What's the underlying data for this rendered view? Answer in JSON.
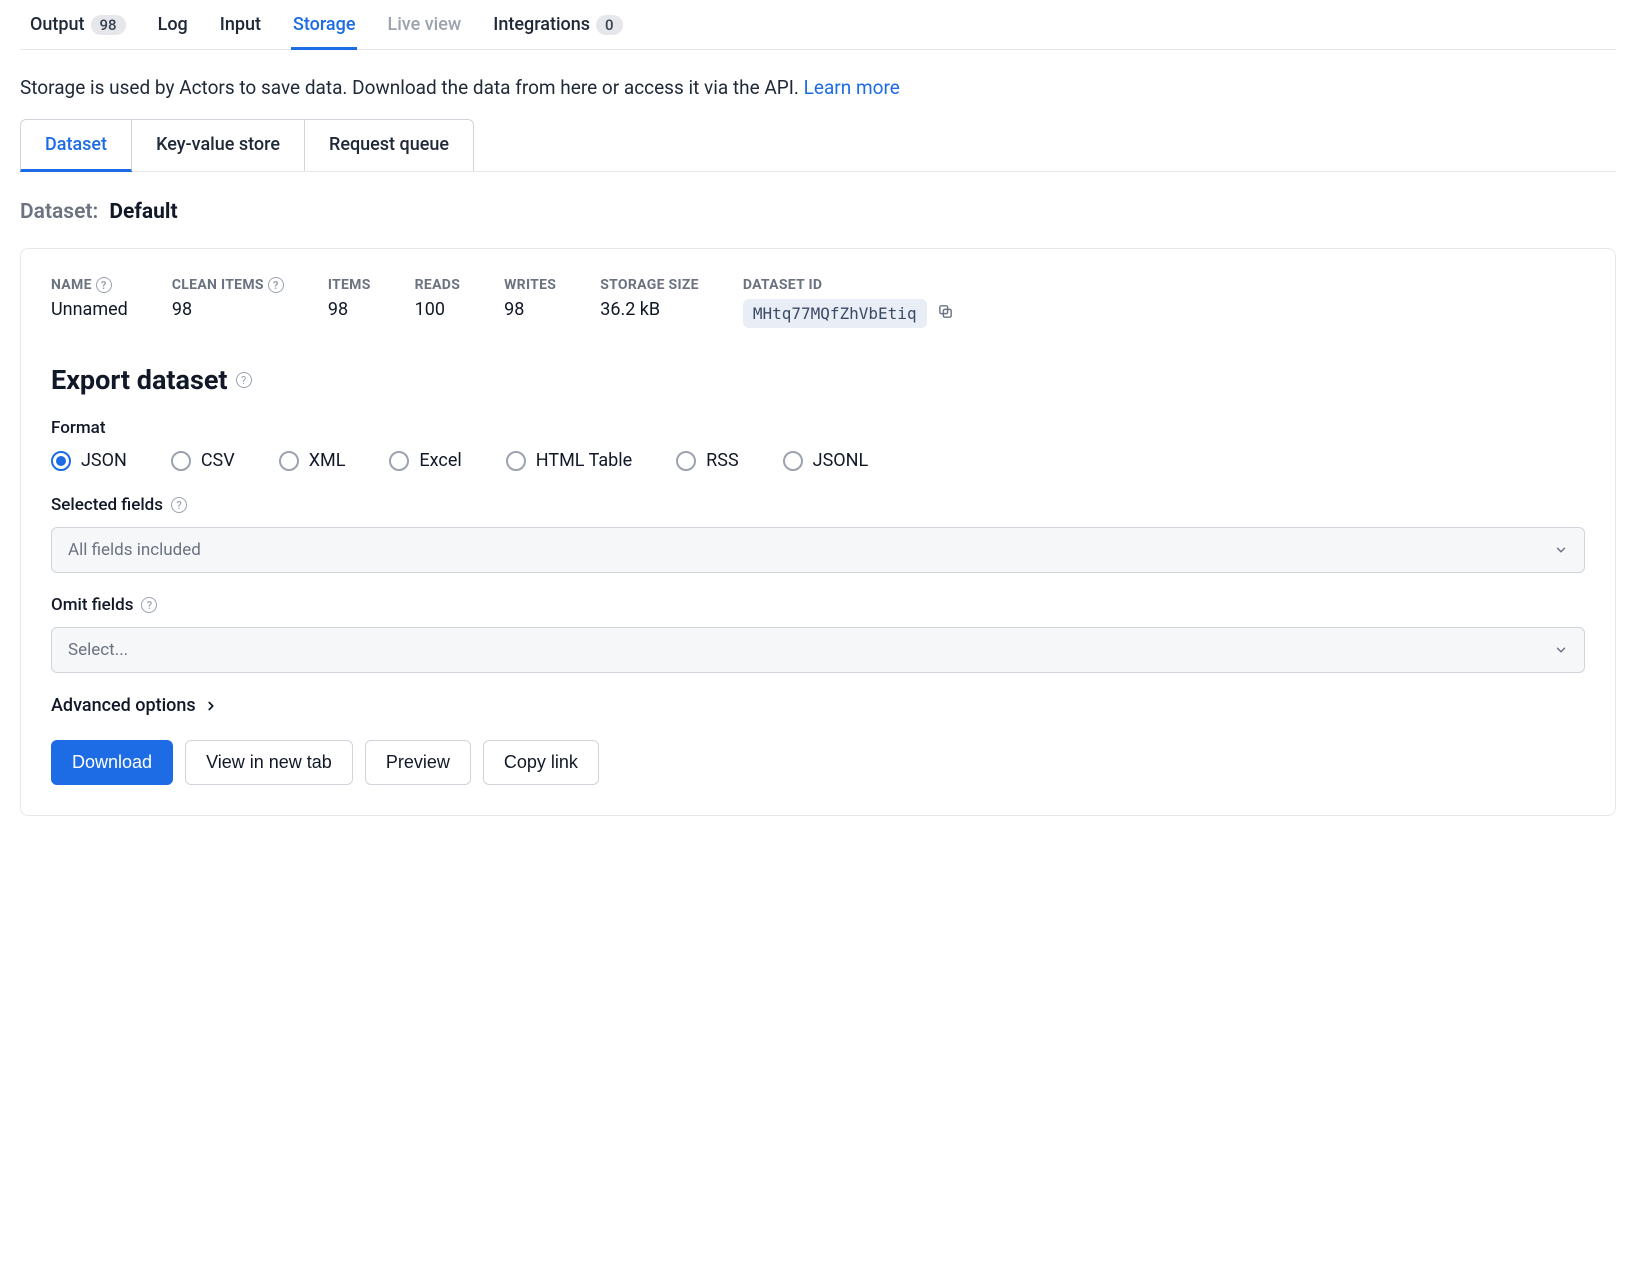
{
  "topTabs": {
    "output": {
      "label": "Output",
      "badge": "98"
    },
    "log": {
      "label": "Log"
    },
    "input": {
      "label": "Input"
    },
    "storage": {
      "label": "Storage"
    },
    "liveview": {
      "label": "Live view"
    },
    "integrations": {
      "label": "Integrations",
      "badge": "0"
    }
  },
  "description": "Storage is used by Actors to save data. Download the data from here or access it via the API. ",
  "learnMore": "Learn more",
  "subtabs": {
    "dataset": "Dataset",
    "kv": "Key-value store",
    "rq": "Request queue"
  },
  "datasetHeading": {
    "label": "Dataset:",
    "value": "Default"
  },
  "stats": {
    "name": {
      "label": "NAME",
      "value": "Unnamed"
    },
    "cleanItems": {
      "label": "CLEAN ITEMS",
      "value": "98"
    },
    "items": {
      "label": "ITEMS",
      "value": "98"
    },
    "reads": {
      "label": "READS",
      "value": "100"
    },
    "writes": {
      "label": "WRITES",
      "value": "98"
    },
    "storageSize": {
      "label": "STORAGE SIZE",
      "value": "36.2 kB"
    },
    "datasetId": {
      "label": "DATASET ID",
      "value": "MHtq77MQfZhVbEtiq"
    }
  },
  "export": {
    "heading": "Export dataset",
    "formatLabel": "Format",
    "formats": {
      "json": "JSON",
      "csv": "CSV",
      "xml": "XML",
      "excel": "Excel",
      "html": "HTML Table",
      "rss": "RSS",
      "jsonl": "JSONL"
    },
    "selectedFields": {
      "label": "Selected fields",
      "placeholder": "All fields included"
    },
    "omitFields": {
      "label": "Omit fields",
      "placeholder": "Select..."
    },
    "advanced": "Advanced options"
  },
  "actions": {
    "download": "Download",
    "viewNewTab": "View in new tab",
    "preview": "Preview",
    "copyLink": "Copy link"
  }
}
